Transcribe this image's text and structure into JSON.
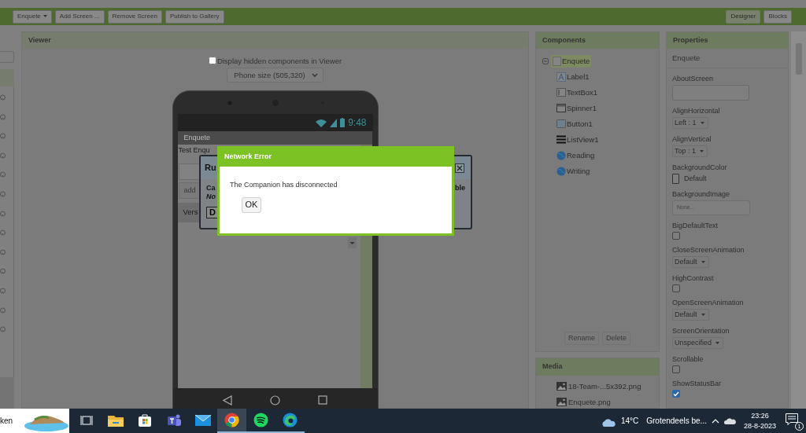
{
  "toolbar": {
    "left_buttons": [
      {
        "label": "Enquete",
        "kind": "dropdown"
      },
      {
        "label": "Add Screen ...",
        "kind": "plain"
      },
      {
        "label": "Remove Screen",
        "kind": "plain"
      },
      {
        "label": "Publish to Gallery",
        "kind": "plain"
      }
    ],
    "right_buttons": [
      {
        "label": "Designer",
        "selected": true
      },
      {
        "label": "Blocks",
        "selected": false
      }
    ]
  },
  "viewer": {
    "title": "Viewer",
    "hidden_checkbox": {
      "label": "Display hidden components in Viewer",
      "checked": false
    },
    "phone_size": "Phone size (505,320)",
    "phone": {
      "time": "9:48",
      "app_title": "Enquete",
      "label_text": "Test Enqu",
      "button_text": "add",
      "list_text": "Vers"
    }
  },
  "background_dialog": {
    "title": "Ru",
    "message_start": "Ca",
    "message_end": "ble",
    "note": "No",
    "button": "D"
  },
  "dialog": {
    "title": "Network Error",
    "message": "The Companion has disconnected",
    "button": "OK"
  },
  "components": {
    "title": "Components",
    "tree": [
      {
        "name": "Enquete",
        "kind": "screen",
        "selected": true,
        "expanded": true,
        "children": [
          {
            "name": "Label1",
            "kind": "label",
            "selected": false
          },
          {
            "name": "TextBox1",
            "kind": "textbox",
            "selected": false
          },
          {
            "name": "Spinner1",
            "kind": "spinner",
            "selected": false
          },
          {
            "name": "Button1",
            "kind": "button",
            "selected": false
          },
          {
            "name": "ListView1",
            "kind": "listview",
            "selected": false
          },
          {
            "name": "Reading",
            "kind": "web",
            "selected": false
          },
          {
            "name": "Writing",
            "kind": "web",
            "selected": false
          }
        ]
      }
    ],
    "buttons": [
      {
        "label": "Rename",
        "disabled": true
      },
      {
        "label": "Delete",
        "disabled": true
      }
    ]
  },
  "media": {
    "title": "Media",
    "files": [
      "18-Team-...5x392.png",
      "Enquete.png"
    ]
  },
  "properties": {
    "title": "Properties",
    "component": "Enquete",
    "items": [
      {
        "name": "AboutScreen",
        "kind": "textarea"
      },
      {
        "name": "AlignHorizontal",
        "kind": "select",
        "value": "Left : 1"
      },
      {
        "name": "AlignVertical",
        "kind": "select",
        "value": "Top : 1"
      },
      {
        "name": "BackgroundColor",
        "kind": "color",
        "value": "Default"
      },
      {
        "name": "BackgroundImage",
        "kind": "asset",
        "value": "None..."
      },
      {
        "name": "BigDefaultText",
        "kind": "checkbox",
        "checked": false
      },
      {
        "name": "CloseScreenAnimation",
        "kind": "select",
        "value": "Default"
      },
      {
        "name": "HighContrast",
        "kind": "checkbox",
        "checked": false
      },
      {
        "name": "OpenScreenAnimation",
        "kind": "select",
        "value": "Default"
      },
      {
        "name": "ScreenOrientation",
        "kind": "select",
        "value": "Unspecified"
      },
      {
        "name": "Scrollable",
        "kind": "checkbox",
        "checked": false
      },
      {
        "name": "ShowStatusBar",
        "kind": "checkbox",
        "checked": true
      }
    ]
  },
  "taskbar": {
    "search_text": "ken",
    "apps": [
      {
        "kind": "taskview",
        "selected": false,
        "running": false
      },
      {
        "kind": "explorer",
        "selected": false,
        "running": false
      },
      {
        "kind": "store",
        "selected": false,
        "running": false
      },
      {
        "kind": "teams",
        "selected": false,
        "running": false
      },
      {
        "kind": "mail",
        "selected": false,
        "running": false
      },
      {
        "kind": "chrome",
        "selected": true,
        "running": true
      },
      {
        "kind": "spotify",
        "selected": false,
        "running": true
      },
      {
        "kind": "edge",
        "selected": false,
        "running": true
      }
    ],
    "weather": {
      "temperature": "14°C",
      "summary": "Grotendeels be..."
    },
    "time": "23:26",
    "date": "28-8-2023",
    "notifications": "1"
  }
}
